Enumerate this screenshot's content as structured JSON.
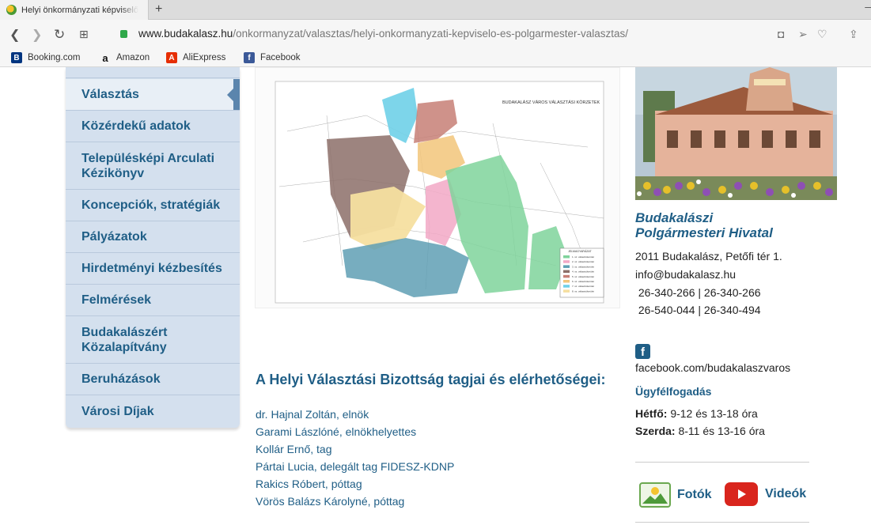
{
  "browser": {
    "tab_title": "Helyi önkormányzati képviselő",
    "url_host": "www.budakalasz.hu",
    "url_path": "/onkormanyzat/valasztas/helyi-onkormanyzati-kepviselo-es-polgarmester-valasztas/",
    "bookmarks": [
      {
        "label": "Booking.com",
        "icon": "B",
        "color": "#003580"
      },
      {
        "label": "Amazon",
        "icon": "a",
        "color": "#111111"
      },
      {
        "label": "AliExpress",
        "icon": "A",
        "color": "#e62e04"
      },
      {
        "label": "Facebook",
        "icon": "f",
        "color": "#3b5998"
      }
    ]
  },
  "sidebar": {
    "items": [
      {
        "label": "Választás",
        "active": true
      },
      {
        "label": "Közérdekű adatok"
      },
      {
        "label": "Településképi Arculati Kézikönyv"
      },
      {
        "label": "Koncepciók, stratégiák"
      },
      {
        "label": "Pályázatok"
      },
      {
        "label": "Hirdetményi kézbesítés"
      },
      {
        "label": "Felmérések"
      },
      {
        "label": "Budakalászért Közalapítvány"
      },
      {
        "label": "Beruházások"
      },
      {
        "label": "Városi Díjak"
      }
    ]
  },
  "map": {
    "title": "BUDAKALÁSZ VÁROS VÁLASZTÁSI KÖRZETEK",
    "legend_title": "JELMAGYARÁZAT",
    "legend": [
      {
        "label": "1. sz. választókerület",
        "color": "#7fd39b"
      },
      {
        "label": "2. sz. választókerület",
        "color": "#f2a8c6"
      },
      {
        "label": "3. sz. választókerület",
        "color": "#5f9fb4"
      },
      {
        "label": "4. sz. választókerület",
        "color": "#8c6e68"
      },
      {
        "label": "5. sz. választókerület",
        "color": "#c77f76"
      },
      {
        "label": "6. sz. választókerület",
        "color": "#f2c57a"
      },
      {
        "label": "7. sz. választókerület",
        "color": "#6fd0e8"
      },
      {
        "label": "8. sz. választókerület",
        "color": "#f6dfa0"
      }
    ]
  },
  "content": {
    "title": "A Helyi Választási Bizottság tagjai és elérhetőségei:",
    "members": [
      "dr. Hajnal Zoltán, elnök",
      "Garami Lászlóné, elnökhelyettes",
      "Kollár Ernő, tag",
      "Pártai Lucia, delegált tag  FIDESZ-KDNP",
      "Rakics Róbert, póttag",
      "Vörös Balázs Károlyné, póttag"
    ]
  },
  "right": {
    "office_line1": "Budakalászi",
    "office_line2": "Polgármesteri Hivatal",
    "address": "2011 Budakalász, Petőfi tér 1.",
    "email": "info@budakalasz.hu",
    "phone1": " 26-340-266 | 26-340-266",
    "phone2": " 26-540-044 | 26-340-494",
    "facebook": "facebook.com/budakalaszvaros",
    "ugyfelfogadas": "Ügyfélfogadás",
    "hours": [
      {
        "day": "Hétfő:",
        "time": " 9-12 és 13-18 óra"
      },
      {
        "day": "Szerda:",
        "time": " 8-11 és 13-16 óra"
      }
    ],
    "photos_label": "Fotók",
    "videos_label": "Videók"
  }
}
